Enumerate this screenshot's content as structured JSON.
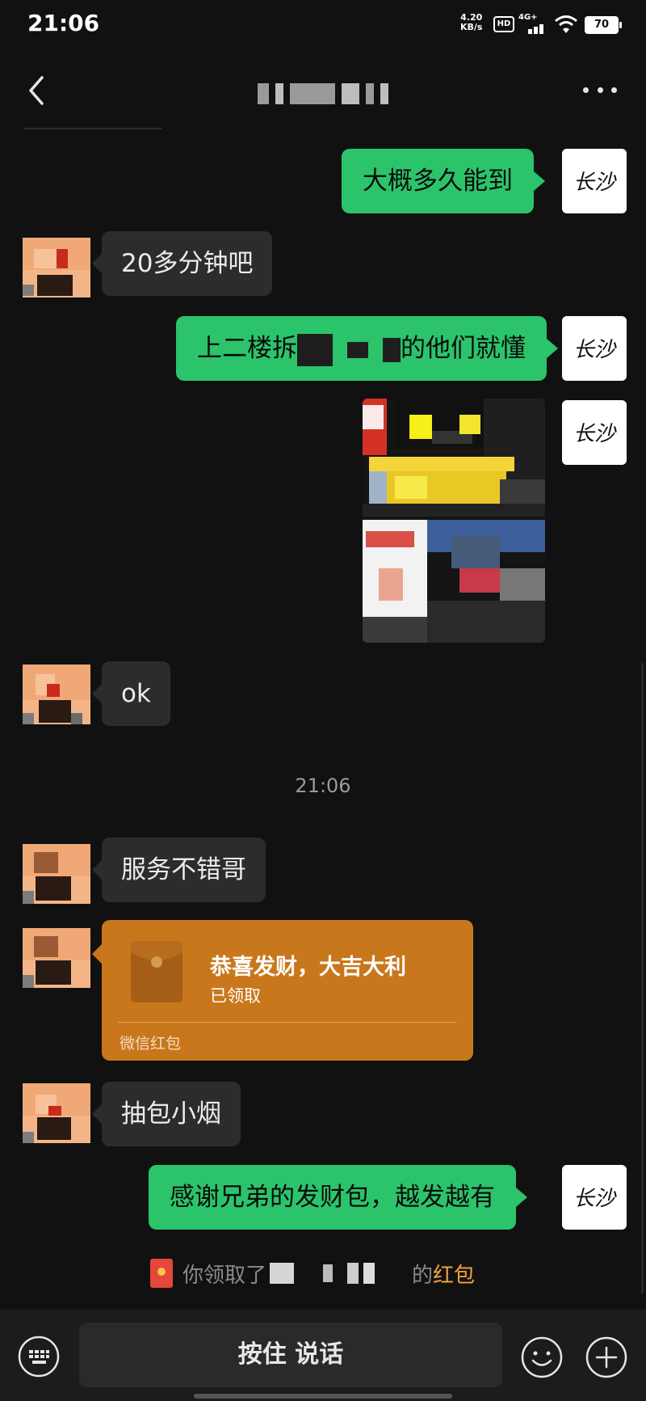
{
  "status_bar": {
    "time": "21:06",
    "net_speed_value": "4.20",
    "net_speed_unit": "KB/s",
    "hd_label": "HD",
    "network_label": "4G+",
    "battery": "70"
  },
  "header": {
    "back_icon": "chevron-left-icon",
    "more_icon": "more-dots-icon"
  },
  "messages": [
    {
      "side": "out",
      "text": "大概多久能到"
    },
    {
      "side": "in",
      "text": "20多分钟吧"
    },
    {
      "side": "out",
      "text_parts": [
        "上二楼拆",
        "",
        "",
        "的他们就懂"
      ]
    },
    {
      "side": "out",
      "type": "image"
    },
    {
      "side": "in",
      "text": "ok"
    },
    {
      "type": "time",
      "text": "21:06"
    },
    {
      "side": "in",
      "text": "服务不错哥"
    },
    {
      "side": "in",
      "type": "red_packet",
      "title": "恭喜发财，大吉大利",
      "status": "已领取",
      "footer": "微信红包"
    },
    {
      "side": "in",
      "text": "抽包小烟"
    },
    {
      "side": "out",
      "text": "感谢兄弟的发财包，越发越有"
    }
  ],
  "my_avatar_text": "长沙",
  "system_notice": {
    "prefix": "你领取了",
    "suffix": "的",
    "link": "红包"
  },
  "input_bar": {
    "hold_to_talk": "按住 说话",
    "left_icon": "keyboard-icon",
    "emoji_icon": "emoji-icon",
    "plus_icon": "plus-icon"
  }
}
